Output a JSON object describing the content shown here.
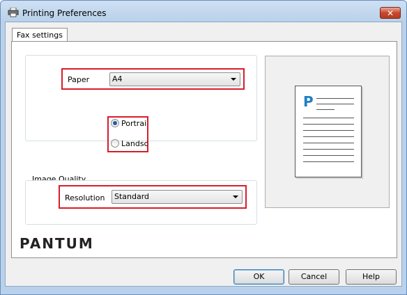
{
  "window": {
    "title": "Printing Preferences",
    "close_label": "✕"
  },
  "tabs": [
    {
      "label": "Fax settings",
      "selected": true
    }
  ],
  "paper": {
    "label": "Paper",
    "value": "A4"
  },
  "orientation": {
    "options": [
      {
        "label": "Portrai",
        "checked": true
      },
      {
        "label": "Landsc",
        "checked": false
      }
    ]
  },
  "image_quality": {
    "group_label": "Image Quality",
    "resolution_label": "Resolution",
    "resolution_value": "Standard"
  },
  "preview": {
    "page_letter": "P"
  },
  "brand": {
    "logo_text": "PANTUM"
  },
  "buttons": {
    "ok": "OK",
    "cancel": "Cancel",
    "help": "Help"
  },
  "colors": {
    "highlight": "#d71d2b",
    "preview_letter": "#1f7fc4"
  }
}
